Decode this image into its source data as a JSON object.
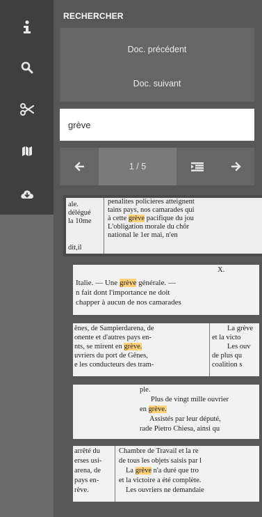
{
  "panel": {
    "title": "RECHERCHER",
    "prev_doc": "Doc. précédent",
    "next_doc": "Doc. suivant",
    "search_value": "grève",
    "pager_count": "1 / 5"
  },
  "rail": {
    "icons": [
      "info-icon",
      "search-icon",
      "scissors-icon",
      "map-icon",
      "cloud-download-icon"
    ]
  },
  "snippets": [
    {
      "left_col": [
        "ale.",
        "délégué",
        "la 10me",
        "dit,il"
      ],
      "right_col": [
        [
          "penalites policieres atteignent",
          ""
        ],
        [
          "tains pays, nos camarades qui",
          ""
        ],
        [
          "à cette ",
          "grève",
          " pacifique du jou"
        ],
        [
          "  L'obligation morale du chôr",
          ""
        ],
        [
          "national le 1er mai, n'en",
          ""
        ]
      ]
    },
    {
      "lines": [
        [
          "X.",
          "",
          ""
        ],
        [
          "Italie. — Une ",
          "grève",
          " générale. —"
        ],
        [
          "n fait dont l'importance ne doit",
          "",
          ""
        ],
        [
          "chapper à aucun de nos camarades",
          "",
          ""
        ]
      ]
    },
    {
      "left_col": [
        [
          "ênes, de Sampierdarena, de",
          ""
        ],
        [
          "onente et d'autres pays en-",
          ""
        ],
        [
          "nts, se mirent en ",
          "grève."
        ],
        [
          "uvriers du port de Gênes,",
          ""
        ],
        [
          "e les conducteurs des tram-",
          ""
        ]
      ],
      "right_col": [
        "La grève",
        "et la victo",
        "Les ouv",
        "de plus qu",
        "coalition s"
      ]
    },
    {
      "lines": [
        [
          "ple.",
          "",
          ""
        ],
        [
          "Plus de vingt mille ouvrier",
          "",
          ""
        ],
        [
          "en ",
          "grève.",
          ""
        ],
        [
          "Assistés par leur député,",
          "",
          ""
        ],
        [
          "rade Pietro Chiesa, ainsi qu",
          "",
          ""
        ]
      ]
    },
    {
      "left_col": [
        "arrêté du",
        "erses usi-",
        "arena, de",
        "pays en-",
        "rève."
      ],
      "right_col": [
        [
          "Chambre de Travail et la re",
          ""
        ],
        [
          "de tous les objets saisis par l",
          ""
        ],
        [
          "La ",
          "grève",
          " n'a duré que tro"
        ],
        [
          "et la victoire a été complète.",
          ""
        ],
        [
          "Les ouvriers ne demandaie",
          ""
        ]
      ]
    }
  ],
  "colors": {
    "rail_dark": "#3f3f3f",
    "panel": "#575757",
    "button": "#666666",
    "highlight": "#ffd27a"
  }
}
